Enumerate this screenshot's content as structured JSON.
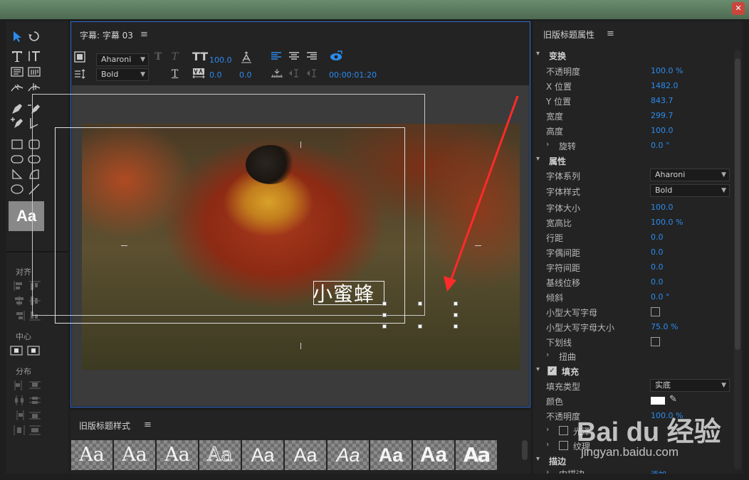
{
  "window": {
    "menu_items": [
      "",
      "",
      "",
      "",
      ""
    ]
  },
  "tools": {
    "swatch_label": "Aa",
    "align_label": "对齐",
    "center_label": "中心",
    "distribute_label": "分布"
  },
  "title_panel": {
    "tab_label": "字幕: 字幕 03",
    "menu_glyph": "≡",
    "font_family": "Aharoni",
    "font_style": "Bold",
    "font_size": "100.0",
    "kerning": "0.0",
    "leading": "0.0",
    "timecode": "00:00:01:20",
    "title_text": "小蜜蜂"
  },
  "styles_panel": {
    "tab_label": "旧版标题样式",
    "menu_glyph": "≡",
    "swatches": [
      "Aa",
      "Aa",
      "Aa",
      "Aa",
      "Aa",
      "Aa",
      "Aa",
      "Aa",
      "Aa",
      "Aa"
    ]
  },
  "properties": {
    "header": "旧版标题属性",
    "menu_glyph": "≡",
    "transform": {
      "label": "变换",
      "opacity_label": "不透明度",
      "opacity": "100.0 %",
      "x_label": "X 位置",
      "x": "1482.0",
      "y_label": "Y 位置",
      "y": "843.7",
      "width_label": "宽度",
      "width": "299.7",
      "height_label": "高度",
      "height": "100.0",
      "rotation_label": "旋转",
      "rotation": "0.0 °"
    },
    "attributes": {
      "label": "属性",
      "font_family_label": "字体系列",
      "font_family": "Aharoni",
      "font_style_label": "字体样式",
      "font_style": "Bold",
      "font_size_label": "字体大小",
      "font_size": "100.0",
      "aspect_label": "宽高比",
      "aspect": "100.0 %",
      "leading_label": "行距",
      "leading": "0.0",
      "kerning_label": "字偶间距",
      "kerning": "0.0",
      "tracking_label": "字符间距",
      "tracking": "0.0",
      "baseline_label": "基线位移",
      "baseline": "0.0",
      "slant_label": "倾斜",
      "slant": "0.0 °",
      "small_caps_label": "小型大写字母",
      "small_caps_size_label": "小型大写字母大小",
      "small_caps_size": "75.0 %",
      "underline_label": "下划线",
      "distort_label": "扭曲"
    },
    "fill": {
      "label": "填充",
      "fill_type_label": "填充类型",
      "fill_type": "实底",
      "color_label": "颜色",
      "opacity_label": "不透明度",
      "opacity": "100.0 %",
      "sheen_label": "光泽",
      "texture_label": "纹理"
    },
    "stroke": {
      "label": "描边",
      "inner_label": "内描边",
      "inner_value": "添加"
    }
  },
  "watermark": {
    "logo": "Bai du 经验",
    "url": "jingyan.baidu.com"
  },
  "colors": {
    "accent": "#2b8cf0",
    "annotation_arrow": "#ff2a2a",
    "panel_focus_border": "#2e6bd0"
  }
}
